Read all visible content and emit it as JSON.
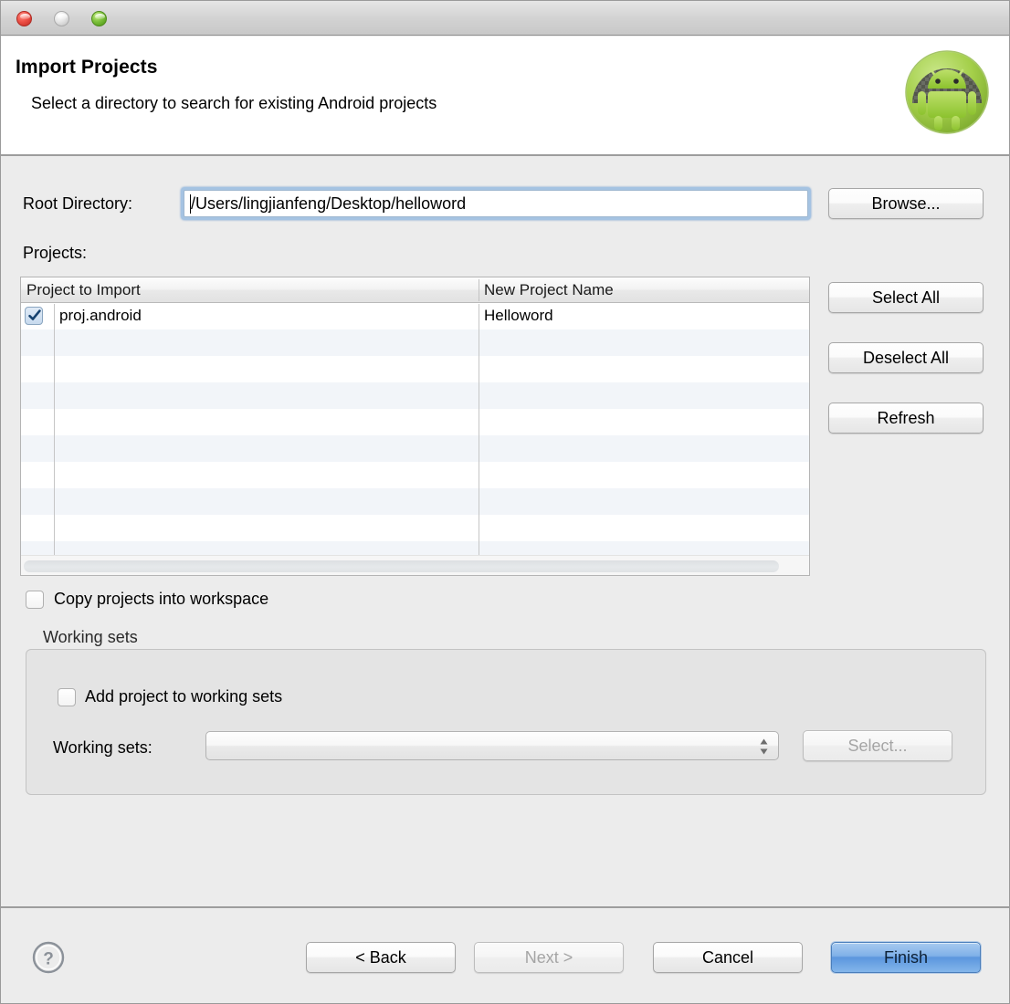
{
  "window": {
    "traffic_lights": [
      "close",
      "minimize",
      "zoom"
    ]
  },
  "header": {
    "title": "Import Projects",
    "subtitle": "Select a directory to search for existing Android projects",
    "badge_icon": "android-robot-icon"
  },
  "form": {
    "root_directory_label": "Root Directory:",
    "root_directory_value": "/Users/lingjianfeng/Desktop/helloword",
    "root_directory_placeholder": "",
    "projects_label": "Projects:"
  },
  "table": {
    "columns": [
      "Project to Import",
      "New Project Name"
    ],
    "rows": [
      {
        "checked": true,
        "project": "proj.android",
        "new_name": "Helloword"
      },
      {
        "checked": false,
        "project": "",
        "new_name": ""
      },
      {
        "checked": false,
        "project": "",
        "new_name": ""
      },
      {
        "checked": false,
        "project": "",
        "new_name": ""
      },
      {
        "checked": false,
        "project": "",
        "new_name": ""
      },
      {
        "checked": false,
        "project": "",
        "new_name": ""
      },
      {
        "checked": false,
        "project": "",
        "new_name": ""
      },
      {
        "checked": false,
        "project": "",
        "new_name": ""
      },
      {
        "checked": false,
        "project": "",
        "new_name": ""
      },
      {
        "checked": false,
        "project": "",
        "new_name": ""
      }
    ]
  },
  "side_buttons": {
    "browse": "Browse...",
    "select_all": "Select All",
    "deselect_all": "Deselect All",
    "refresh": "Refresh"
  },
  "options": {
    "copy_projects_label": "Copy projects into workspace",
    "copy_projects_checked": false
  },
  "working_sets": {
    "legend": "Working sets",
    "add_project_label": "Add project to working sets",
    "add_project_checked": false,
    "combo_label": "Working sets:",
    "combo_value": "",
    "select_button": "Select...",
    "select_button_enabled": false
  },
  "footer": {
    "help_icon": "help-question-icon",
    "back": "< Back",
    "next": "Next >",
    "cancel": "Cancel",
    "finish": "Finish",
    "next_enabled": false,
    "default_button": "Finish"
  },
  "colors": {
    "dialog_background": "#ececec",
    "header_background": "#ffffff",
    "focus_ring": "#6ca3db",
    "default_button": "#5b96de",
    "row_alt": "#f2f5f9",
    "android_green": "#7ec13c"
  }
}
